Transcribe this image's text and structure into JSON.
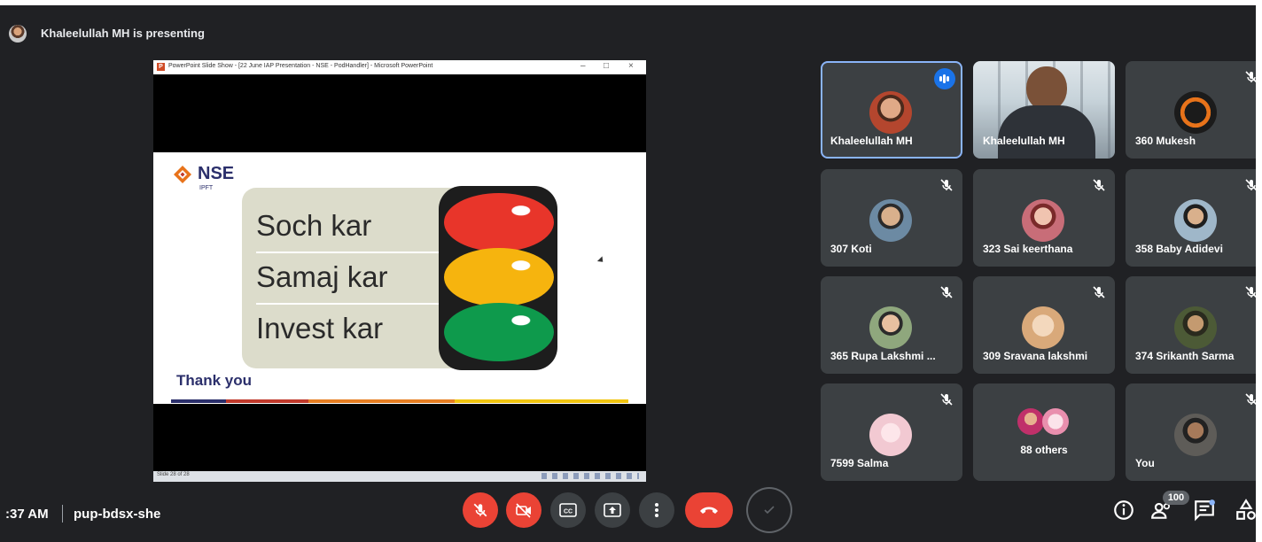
{
  "header": {
    "presenting_text": "Khaleelullah MH is presenting"
  },
  "shared_window": {
    "title": "PowerPoint Slide Show - [22 June IAP Presentation - NSE - PodHandler] - Microsoft PowerPoint",
    "window_controls": [
      "–",
      "□",
      "×"
    ],
    "status": "Slide 28 of 28",
    "slide": {
      "logo_text": "NSE",
      "logo_sub": "IPFT",
      "lines": [
        "Soch kar",
        "Samaj kar",
        "Invest kar"
      ],
      "footer": "Thank you",
      "light_colors": [
        "#e8352a",
        "#f6b40e",
        "#0e9a4c"
      ]
    }
  },
  "participants": [
    {
      "name": "Khaleelullah MH",
      "speaking": true,
      "avatar_color": "#b4462e"
    },
    {
      "name": "Khaleelullah MH",
      "video": true
    },
    {
      "name": "360 Mukesh",
      "muted": true,
      "avatar_color": "#e8731a"
    },
    {
      "name": "307 Koti",
      "muted": true,
      "avatar_color": "#6c8aa3"
    },
    {
      "name": "323 Sai keerthana",
      "muted": true,
      "avatar_color": "#c86d78"
    },
    {
      "name": "358 Baby Adidevi",
      "muted": true,
      "avatar_color": "#9fb7c9"
    },
    {
      "name": "365 Rupa Lakshmi ...",
      "muted": true,
      "avatar_color": "#8fa77d"
    },
    {
      "name": "309 Sravana lakshmi",
      "muted": true,
      "avatar_color": "#d9a97a"
    },
    {
      "name": "374 Srikanth Sarma",
      "muted": true,
      "avatar_color": "#4c5a36"
    },
    {
      "name": "7599 Salma",
      "muted": true,
      "avatar_color": "#f2c9d2"
    },
    {
      "name": "88 others",
      "muted": false
    },
    {
      "name": "You",
      "muted": true,
      "avatar_color": "#5e5c58"
    }
  ],
  "bottom_bar": {
    "time": ":37 AM",
    "meeting_code": "pup-bdsx-she",
    "people_count": "100"
  },
  "theme": {
    "background": "#202124",
    "tile": "#3c4043",
    "accent": "#8ab4f8",
    "danger": "#ea4335"
  }
}
